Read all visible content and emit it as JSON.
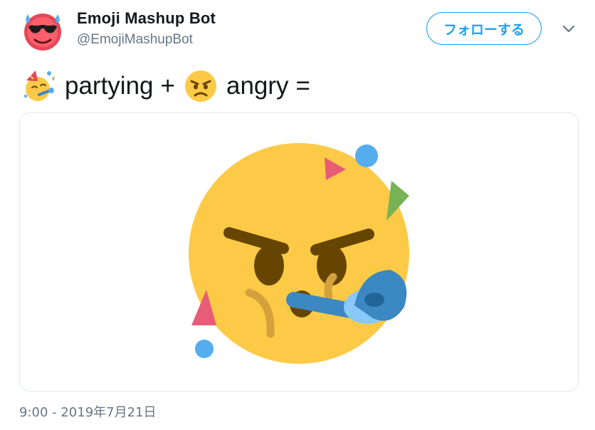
{
  "author": {
    "display_name": "Emoji Mashup Bot",
    "handle": "@EmojiMashupBot",
    "avatar_icon": "sweaty-cool-face-icon"
  },
  "follow_button": {
    "label": "フォローする"
  },
  "menu": {
    "caret_icon": "chevron-down-icon"
  },
  "tweet": {
    "emoji_1_icon": "partying-face-icon",
    "word_1": "partying",
    "plus": "+",
    "emoji_2_icon": "angry-face-icon",
    "word_2": "angry",
    "equals": "="
  },
  "media": {
    "image_icon": "partying-angry-mashup-icon"
  },
  "timestamp": "9:00 - 2019年7月21日",
  "colors": {
    "accent": "#1da1f2",
    "text": "#14171a",
    "secondary": "#657786",
    "border": "#e1e8ed",
    "face": "#fdca47"
  }
}
